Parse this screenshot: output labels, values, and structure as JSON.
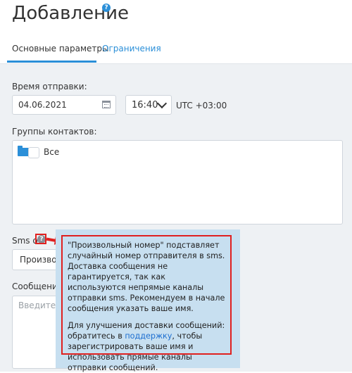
{
  "header": {
    "title": "Добавление",
    "help_badge": "?"
  },
  "tabs": [
    {
      "label": "Основные параметры",
      "active": true
    },
    {
      "label": "Ограничения",
      "active": false
    }
  ],
  "form": {
    "send_time_label": "Время отправки:",
    "date_value": "04.06.2021",
    "time_value": "16:40",
    "timezone": "UTC +03:00",
    "groups_label": "Группы контактов:",
    "groups": [
      {
        "label": "Все"
      }
    ],
    "sms_from_label": "Sms от",
    "help_mark": "?",
    "sender_value": "Произвольный номер",
    "message_label": "Сообщение:",
    "message_placeholder": "Введите текст сообщения"
  },
  "tooltip": {
    "para1": "\"Произвольный номер\" подставляет случайный номер отправителя в sms. Доставка сообщения не гарантируется, так как используются непрямые каналы отправки sms. Рекомендуем в начале сообщения указать ваше имя.",
    "para2_before": "Для улучшения доставки сообщений: обратитесь в ",
    "para2_link": "поддержку",
    "para2_after": ", чтобы зарегистрировать ваше имя и использовать прямые каналы отправки сообщений."
  },
  "colors": {
    "accent": "#2b8fd8",
    "highlight": "#e0201f",
    "tooltip_bg": "#c7dff0",
    "content_bg": "#eef1f4"
  }
}
